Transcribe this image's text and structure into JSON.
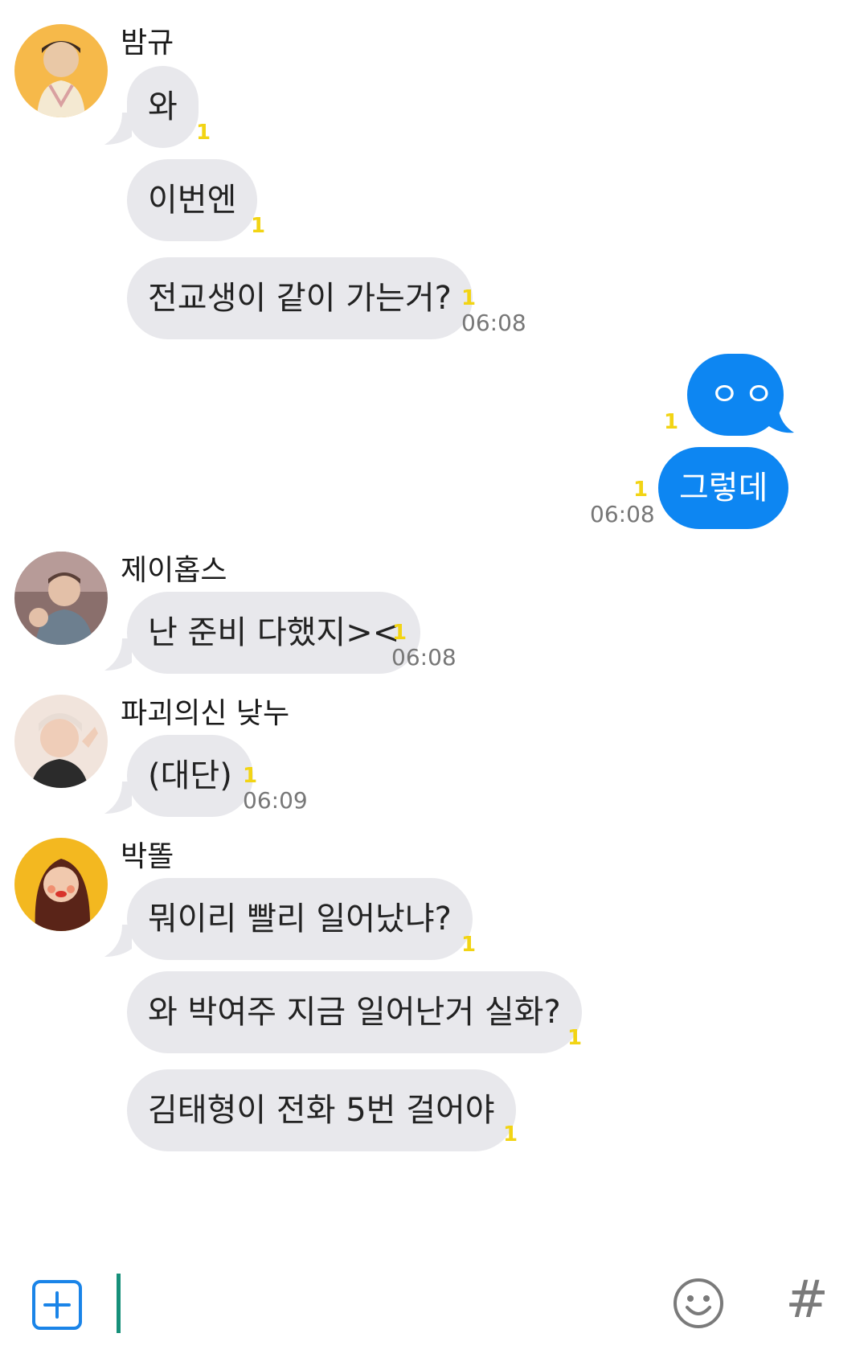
{
  "colors": {
    "incoming_bubble": "#e8e8ec",
    "outgoing_bubble": "#0d86f2",
    "unread_badge": "#f2d414",
    "timestamp": "#777777",
    "cursor": "#16907a",
    "plus_button": "#1a84e8"
  },
  "messages": {
    "g1": {
      "sender": "밤규",
      "m1": "와",
      "m2": "이번엔",
      "m3": "전교생이 같이 가는거?",
      "time": "06:08"
    },
    "me": {
      "m1": "ㅇㅇ",
      "m2": "그렇데",
      "time": "06:08"
    },
    "g2": {
      "sender": "제이홉스",
      "m1": "난 준비 다했지><",
      "time": "06:08"
    },
    "g3": {
      "sender": "파괴의신 낮누",
      "m1": "(대단)",
      "time": "06:09"
    },
    "g4": {
      "sender": "박똘",
      "m1": "뭐이리 빨리 일어났냐?",
      "m2": "와 박여주 지금 일어난거 실화?",
      "m3": "김태형이 전화 5번 걸어야"
    },
    "unread": "1"
  },
  "input_bar": {
    "plus_icon": "plus-square-icon",
    "emoji_icon": "smiley-icon",
    "hash_label": "#"
  }
}
